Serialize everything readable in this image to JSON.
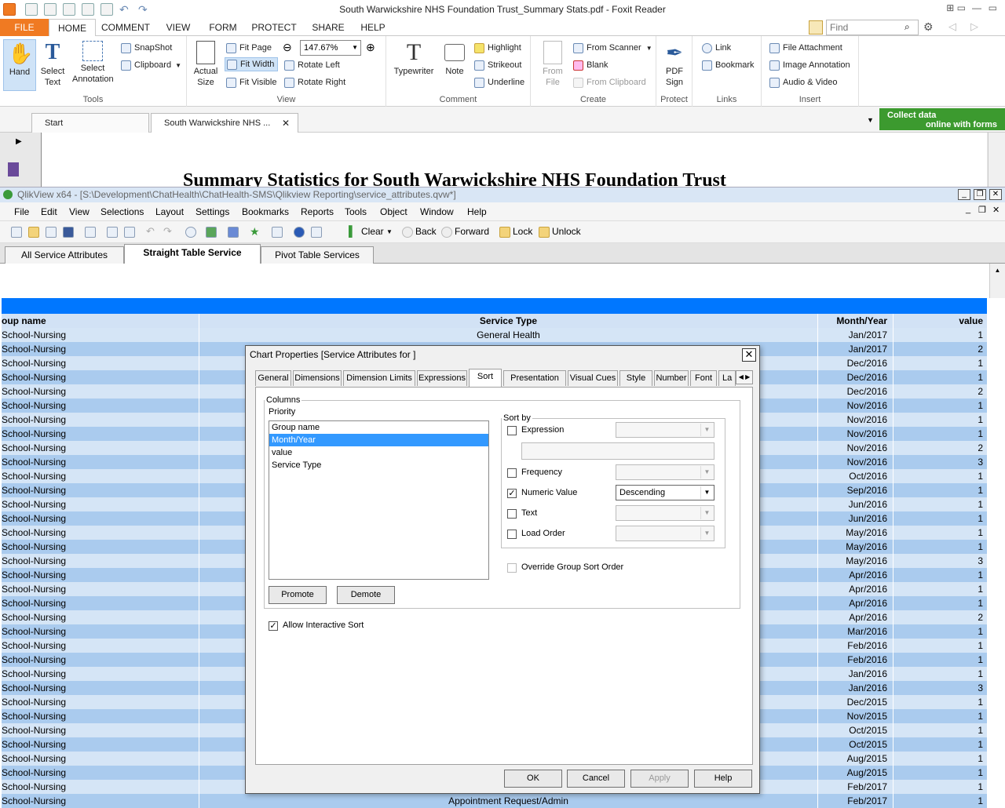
{
  "foxit": {
    "title": "South Warwickshire NHS Foundation Trust_Summary Stats.pdf - Foxit Reader",
    "tabs": [
      "FILE",
      "HOME",
      "COMMENT",
      "VIEW",
      "FORM",
      "PROTECT",
      "SHARE",
      "HELP"
    ],
    "active_tab": "HOME",
    "find_placeholder": "Find",
    "tools_group": {
      "label": "Tools",
      "hand": "Hand",
      "select_text": "Select Text",
      "select_annotation": "Select Annotation",
      "snapshot": "SnapShot",
      "clipboard": "Clipboard"
    },
    "view_group": {
      "label": "View",
      "actual_size": "Actual Size",
      "fit_page": "Fit Page",
      "fit_width": "Fit Width",
      "fit_visible": "Fit Visible",
      "zoom": "147.67%",
      "rotate_left": "Rotate Left",
      "rotate_right": "Rotate Right"
    },
    "comment_group": {
      "label": "Comment",
      "typewriter": "Typewriter",
      "note": "Note",
      "highlight": "Highlight",
      "strikeout": "Strikeout",
      "underline": "Underline"
    },
    "create_group": {
      "label": "Create",
      "from_file": "From File",
      "from_scanner": "From Scanner",
      "blank": "Blank",
      "from_clipboard": "From Clipboard"
    },
    "protect_group": {
      "label": "Protect",
      "pdf_sign": "PDF Sign"
    },
    "links_group": {
      "label": "Links",
      "link": "Link",
      "bookmark": "Bookmark"
    },
    "insert_group": {
      "label": "Insert",
      "file_attachment": "File Attachment",
      "image_annotation": "Image Annotation",
      "audio_video": "Audio & Video"
    },
    "doc_tabs": [
      "Start",
      "South Warwickshire NHS ..."
    ],
    "collect_banner": [
      "Collect data",
      "online with forms"
    ],
    "page_heading": "Summary Statistics  for South Warwickshire NHS Foundation Trust"
  },
  "qlik": {
    "title": "QlikView x64 - [S:\\Development\\ChatHealth\\ChatHealth-SMS\\Qlikview Reporting\\service_attributes.qvw*]",
    "menu": [
      "File",
      "Edit",
      "View",
      "Selections",
      "Layout",
      "Settings",
      "Bookmarks",
      "Reports",
      "Tools",
      "Object",
      "Window",
      "Help"
    ],
    "toolbar": {
      "clear": "Clear",
      "back": "Back",
      "forward": "Forward",
      "lock": "Lock",
      "unlock": "Unlock"
    },
    "sheet_tabs": [
      "All Service Attributes",
      "Straight Table Service",
      "Pivot Table Services"
    ],
    "active_sheet": "Straight Table Service",
    "table": {
      "headers": [
        "oup name",
        "Service Type",
        "Month/Year",
        "value"
      ],
      "rows": [
        [
          "School-Nursing",
          "General Health",
          "Jan/2017",
          "1"
        ],
        [
          "School-Nursing",
          "",
          "Jan/2017",
          "2"
        ],
        [
          "School-Nursing",
          "",
          "Dec/2016",
          "1"
        ],
        [
          "School-Nursing",
          "",
          "Dec/2016",
          "1"
        ],
        [
          "School-Nursing",
          "",
          "Dec/2016",
          "2"
        ],
        [
          "School-Nursing",
          "",
          "Nov/2016",
          "1"
        ],
        [
          "School-Nursing",
          "",
          "Nov/2016",
          "1"
        ],
        [
          "School-Nursing",
          "",
          "Nov/2016",
          "1"
        ],
        [
          "School-Nursing",
          "",
          "Nov/2016",
          "2"
        ],
        [
          "School-Nursing",
          "",
          "Nov/2016",
          "3"
        ],
        [
          "School-Nursing",
          "",
          "Oct/2016",
          "1"
        ],
        [
          "School-Nursing",
          "",
          "Sep/2016",
          "1"
        ],
        [
          "School-Nursing",
          "",
          "Jun/2016",
          "1"
        ],
        [
          "School-Nursing",
          "",
          "Jun/2016",
          "1"
        ],
        [
          "School-Nursing",
          "",
          "May/2016",
          "1"
        ],
        [
          "School-Nursing",
          "",
          "May/2016",
          "1"
        ],
        [
          "School-Nursing",
          "",
          "May/2016",
          "3"
        ],
        [
          "School-Nursing",
          "",
          "Apr/2016",
          "1"
        ],
        [
          "School-Nursing",
          "",
          "Apr/2016",
          "1"
        ],
        [
          "School-Nursing",
          "",
          "Apr/2016",
          "1"
        ],
        [
          "School-Nursing",
          "",
          "Apr/2016",
          "2"
        ],
        [
          "School-Nursing",
          "",
          "Mar/2016",
          "1"
        ],
        [
          "School-Nursing",
          "",
          "Feb/2016",
          "1"
        ],
        [
          "School-Nursing",
          "",
          "Feb/2016",
          "1"
        ],
        [
          "School-Nursing",
          "",
          "Jan/2016",
          "1"
        ],
        [
          "School-Nursing",
          "",
          "Jan/2016",
          "3"
        ],
        [
          "School-Nursing",
          "",
          "Dec/2015",
          "1"
        ],
        [
          "School-Nursing",
          "",
          "Nov/2015",
          "1"
        ],
        [
          "School-Nursing",
          "",
          "Oct/2015",
          "1"
        ],
        [
          "School-Nursing",
          "",
          "Oct/2015",
          "1"
        ],
        [
          "School-Nursing",
          "",
          "Aug/2015",
          "1"
        ],
        [
          "School-Nursing",
          "",
          "Aug/2015",
          "1"
        ],
        [
          "School-Nursing",
          "",
          "Feb/2017",
          "1"
        ],
        [
          "School-Nursing",
          "Appointment Request/Admin",
          "Feb/2017",
          "1"
        ]
      ]
    }
  },
  "dialog": {
    "title": "Chart Properties [Service Attributes for ]",
    "tabs": [
      "General",
      "Dimensions",
      "Dimension Limits",
      "Expressions",
      "Sort",
      "Presentation",
      "Visual Cues",
      "Style",
      "Number",
      "Font",
      "La"
    ],
    "active_tab": "Sort",
    "columns_label": "Columns",
    "priority_label": "Priority",
    "priority_items": [
      "Group name",
      "Month/Year",
      "value",
      "Service Type"
    ],
    "selected_item": "Month/Year",
    "sort_by_label": "Sort by",
    "sort_options": [
      {
        "label": "Expression",
        "checked": false,
        "value": ""
      },
      {
        "label": "Frequency",
        "checked": false,
        "value": ""
      },
      {
        "label": "Numeric Value",
        "checked": true,
        "value": "Descending"
      },
      {
        "label": "Text",
        "checked": false,
        "value": ""
      },
      {
        "label": "Load Order",
        "checked": false,
        "value": ""
      }
    ],
    "override_label": "Override Group Sort Order",
    "promote": "Promote",
    "demote": "Demote",
    "allow_interactive_sort": "Allow Interactive Sort",
    "buttons": {
      "ok": "OK",
      "cancel": "Cancel",
      "apply": "Apply",
      "help": "Help"
    }
  }
}
